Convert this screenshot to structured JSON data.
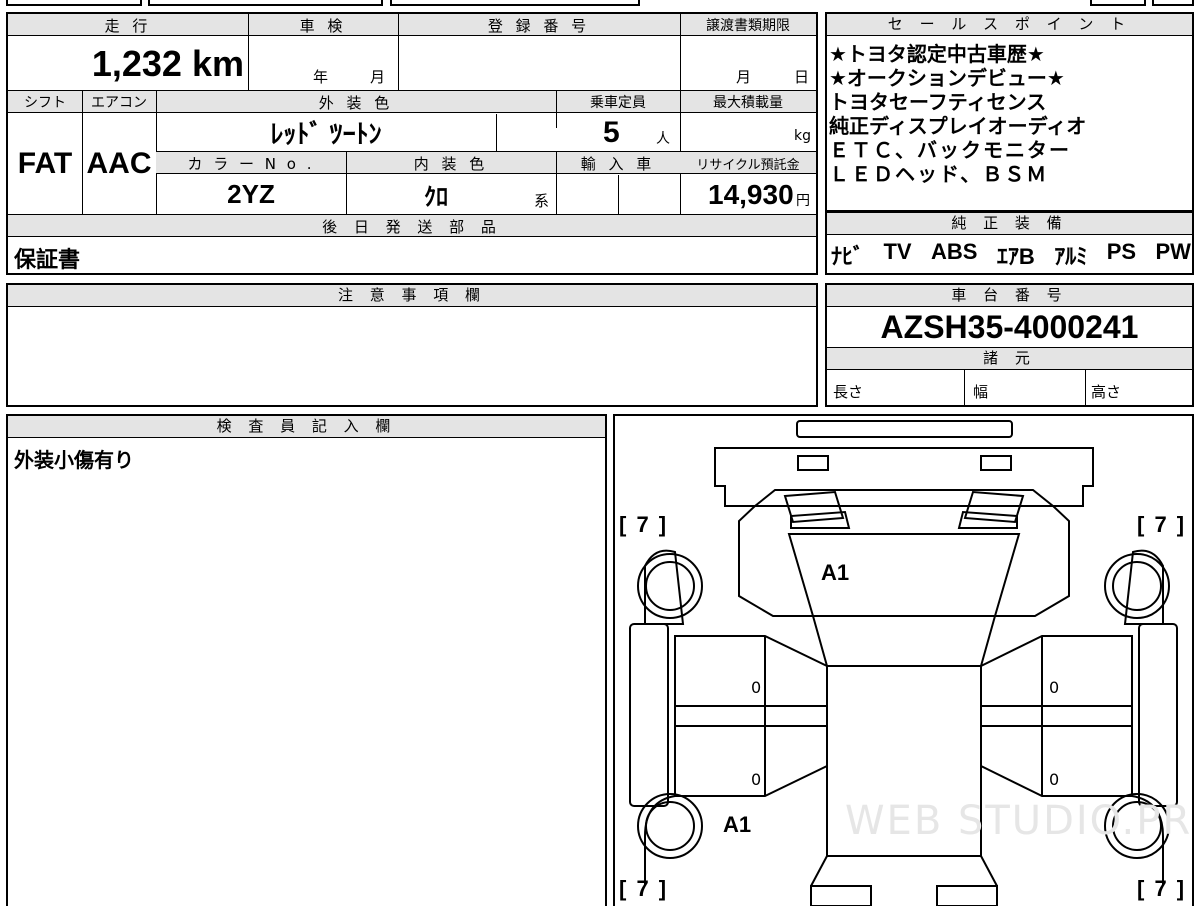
{
  "top_table": {
    "mileage_label": "走 行",
    "mileage_value": "1,232",
    "mileage_unit": "km",
    "inspection_label": "車 検",
    "inspection_year": "年",
    "inspection_month": "月",
    "registration_label": "登 録 番 号",
    "transfer_label": "譲渡書類期限",
    "transfer_month": "月",
    "transfer_day": "日",
    "shift_label": "シフト",
    "ac_label": "エアコン",
    "ext_color_label": "外 装 色",
    "capacity_label": "乗車定員",
    "max_load_label": "最大積載量",
    "shift_value": "FAT",
    "ac_value": "AAC",
    "ext_color_value": "ﾚｯﾄﾞ ﾂｰﾄﾝ",
    "capacity_value": "5",
    "capacity_unit": "人",
    "max_load_unit": "kg",
    "color_no_label": "カ ラ ー N o .",
    "int_color_label": "内 装 色",
    "import_label": "輸 入 車",
    "recycle_label": "リサイクル預託金",
    "color_no_value": "2YZ",
    "int_color_value": "ｸﾛ",
    "int_color_suffix": "系",
    "recycle_value": "14,930",
    "recycle_unit": "円",
    "later_parts_label": "後 日 発 送 部 品",
    "later_parts_value": "保証書"
  },
  "sales_points": {
    "header": "セ ー ル ス ポ イ ン ト",
    "lines": [
      "★トヨタ認定中古車歴★",
      "★オークションデビュー★",
      "トヨタセーフティセンス",
      "純正ディスプレイオーディオ",
      "ＥＴＣ、バックモニター",
      "ＬＥＤヘッド、ＢＳＭ"
    ]
  },
  "equipment": {
    "header": "純 正 装 備",
    "items": [
      "ﾅﾋﾞ",
      "TV",
      "ABS",
      "ｴｱB",
      "ｱﾙﾐ",
      "PS",
      "PW"
    ]
  },
  "notes": {
    "header": "注 意 事 項 欄",
    "text": ""
  },
  "chassis": {
    "header": "車 台 番 号",
    "value": "AZSH35-4000241",
    "specs_header": "諸 元",
    "length_label": "長さ",
    "width_label": "幅",
    "height_label": "高さ"
  },
  "inspector": {
    "header": "検 査 員 記 入 欄",
    "text": "外装小傷有り"
  },
  "diagram": {
    "tire_front_left": "[ 7 ]",
    "tire_front_right": "[ 7 ]",
    "tire_rear_left": "[ 7 ]",
    "tire_rear_right": "[ 7 ]",
    "mark_windshield": "A1",
    "mark_rear_left": "A1",
    "door_fl": "0",
    "door_fr": "0",
    "door_rl": "0",
    "door_rr": "0",
    "watermark": "WEB STUDIO.PRO"
  }
}
